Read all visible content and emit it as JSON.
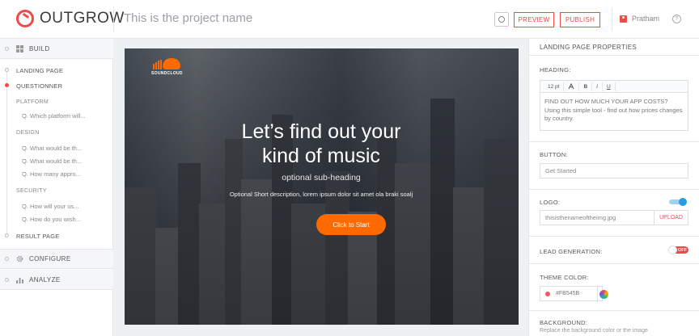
{
  "header": {
    "brand": "OUTGROW",
    "project_name": "This is the project name",
    "preview_label": "PREVIEW",
    "publish_label": "PUBLISH",
    "user_name": "Pratham",
    "help_glyph": "?"
  },
  "sidebar": {
    "build_label": "BUILD",
    "configure_label": "CONFIGURE",
    "analyze_label": "ANALYZE",
    "landing_page": "LANDING PAGE",
    "questionner": "QUESTIONNER",
    "result_page": "RESULT PAGE",
    "groups": [
      {
        "name": "PLATFORM",
        "questions": [
          "Q. Which platform will..."
        ]
      },
      {
        "name": "DESIGN",
        "questions": [
          "Q. What would be th...",
          "Q. What would be th...",
          "Q. How many appro..."
        ]
      },
      {
        "name": "SECURITY",
        "questions": [
          "Q. How will your us...",
          "Q. How do you wish..."
        ]
      }
    ]
  },
  "canvas": {
    "brand_name": "SOUNDCLOUD",
    "title_line1": "Let’s find out your",
    "title_line2": "kind of music",
    "subheading": "optional sub-heading",
    "description": "Optional Short description, lorem ipsum dolor sit amet ola braki soalj",
    "cta_label": "Click to Start",
    "cta_color": "#FF6A00"
  },
  "properties": {
    "title": "LANDING PAGE PROPERTIES",
    "heading_label": "HEADING:",
    "font_size": "12 pt",
    "toolbar": {
      "bold": "B",
      "italic": "I",
      "underline": "U"
    },
    "heading_text": "FIND OUT HOW MUCH YOUR APP COSTS? Using this simple tool - find out how prices changes by country.",
    "button_label": "BUTTON:",
    "button_value": "Get Started",
    "logo_label": "LOGO:",
    "logo_enabled": true,
    "logo_file": "thisisthenameoftheimg.jpg",
    "upload_label": "UPLOAD",
    "lead_label": "LEAD GENERATION:",
    "lead_toggle": "OFF",
    "theme_label": "THEME COLOR:",
    "theme_color": "#FB545B",
    "background_label": "BACKGROUND:",
    "background_hint": "Replace the background color or the image"
  },
  "colors": {
    "accent": "#EF4A4A",
    "toggle_blue": "#2A9DE0"
  }
}
